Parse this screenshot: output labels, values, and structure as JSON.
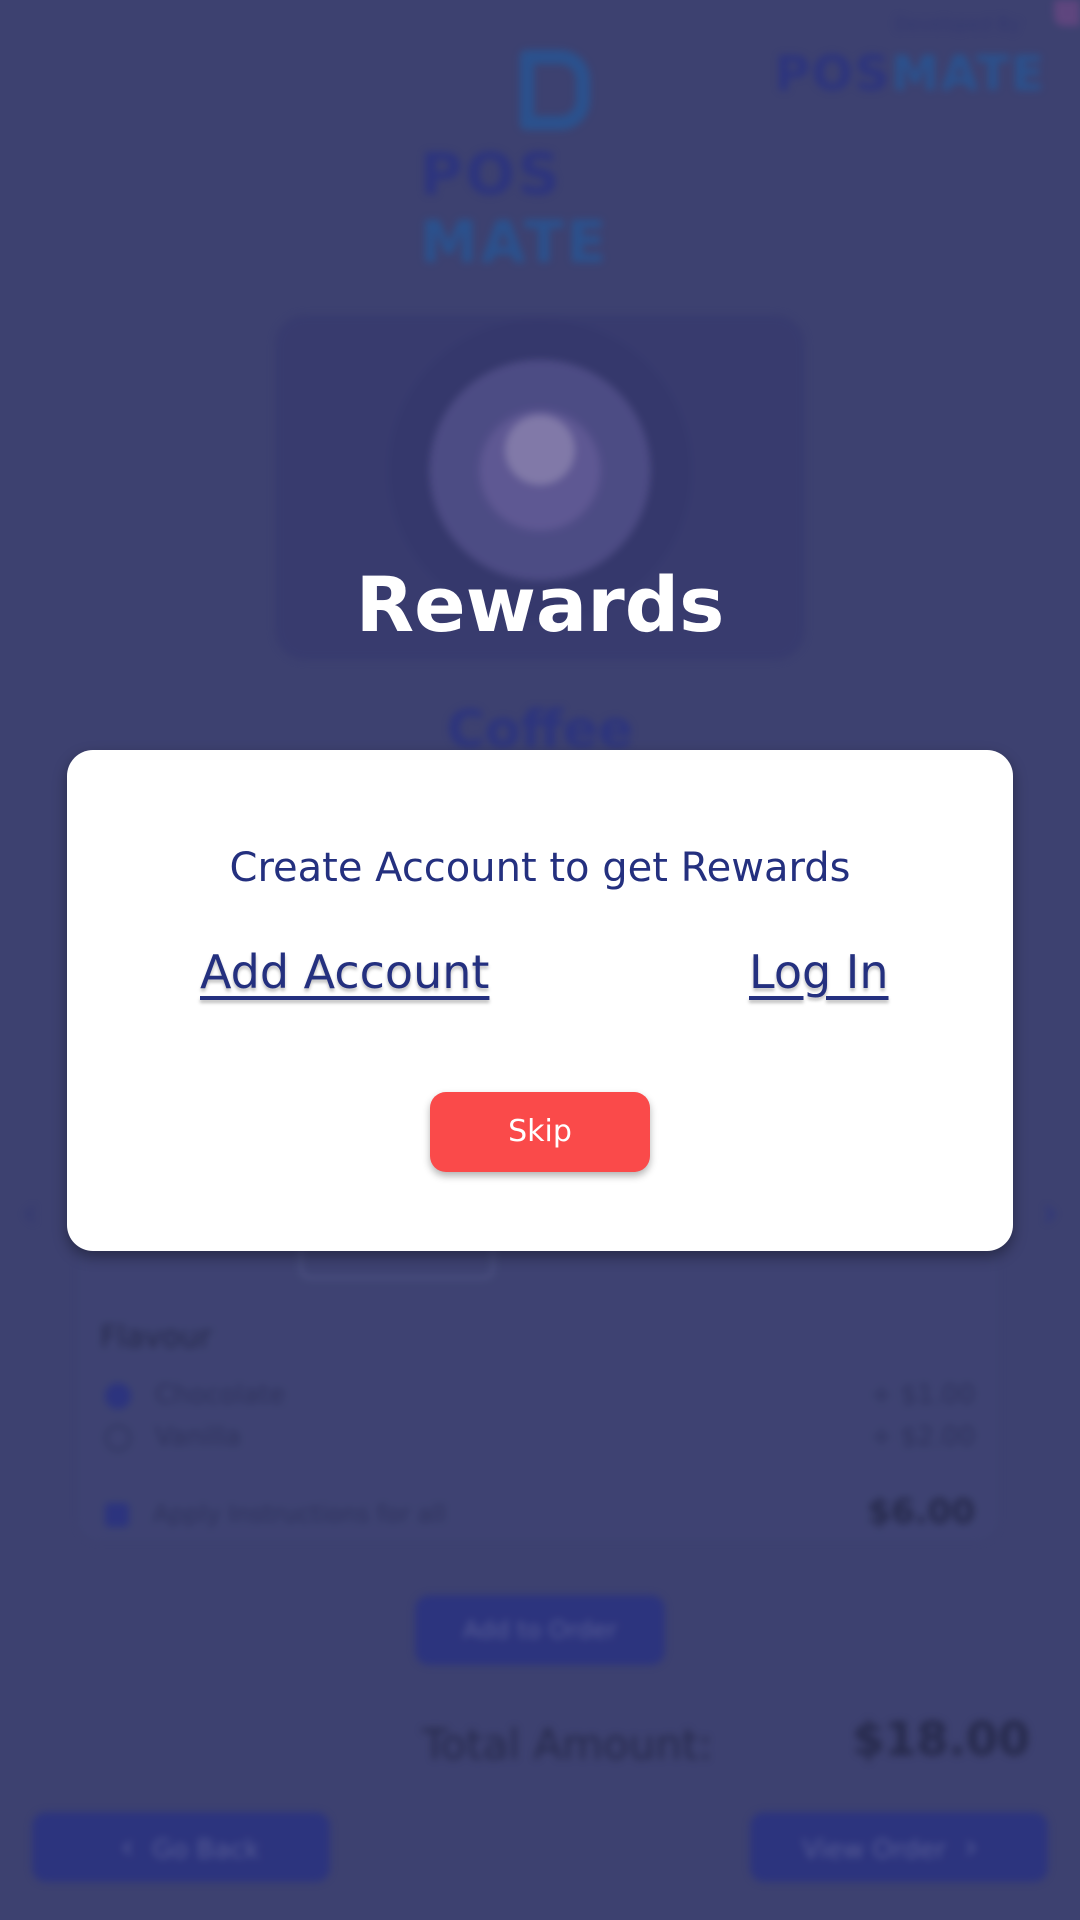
{
  "background": {
    "developed_by_label": "Developed By",
    "dev_logo": {
      "pos": "POS",
      "mate": "MATE"
    },
    "main_logo": {
      "pos": "POS",
      "mate": "MATE"
    },
    "product_name": "Coffee",
    "flavour_title": "Flavour",
    "options": [
      {
        "label": "Chocolate",
        "price": "+ $1.00",
        "selected": true
      },
      {
        "label": "Vanilla",
        "price": "+ $2.00",
        "selected": false
      }
    ],
    "apply_label": "Apply Instructions for all",
    "item_price": "$6.00",
    "add_to_order_label": "Add to Order",
    "total_label": "Total Amount:",
    "total_value": "$18.00",
    "go_back_label": "Go Back",
    "view_order_label": "View Order",
    "icons": {
      "left": "chevron-left-icon",
      "right": "chevron-right-icon"
    }
  },
  "rewards": {
    "title": "Rewards",
    "subtitle": "Create Account to get Rewards",
    "add_account_label": "Add Account",
    "login_label": "Log In",
    "skip_label": "Skip"
  },
  "colors": {
    "overlay": "#3d4170",
    "brand_navy": "#24307f",
    "skip_red": "#fa4a4a"
  }
}
